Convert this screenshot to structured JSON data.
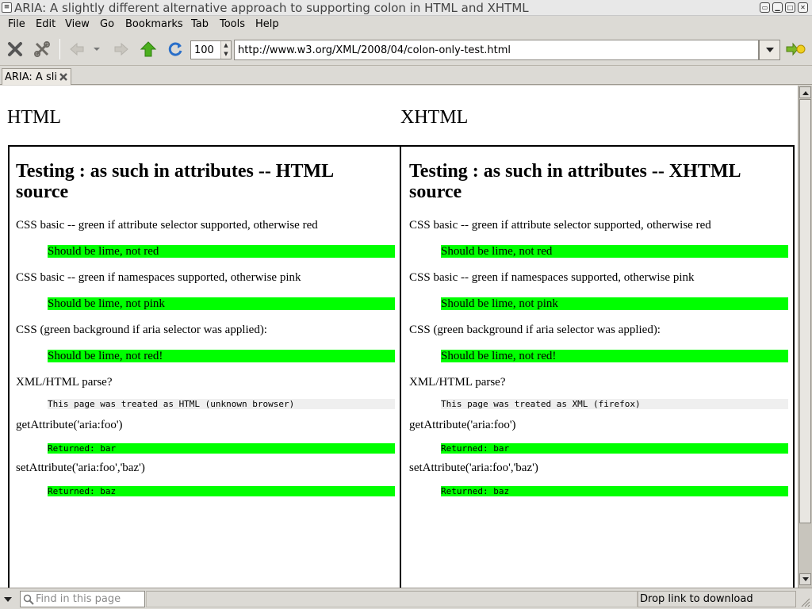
{
  "window": {
    "title": "ARIA: A slightly different alternative approach to supporting colon in HTML and XHTML"
  },
  "menu": [
    "File",
    "Edit",
    "View",
    "Go",
    "Bookmarks",
    "Tab",
    "Tools",
    "Help"
  ],
  "toolbar": {
    "zoom": "100",
    "url": "http://www.w3.org/XML/2008/04/colon-only-test.html",
    "icons": [
      "stop-icon",
      "tools-icon",
      "back-icon",
      "history-dropdown-icon",
      "forward-icon",
      "home-up-icon",
      "reload-icon",
      "go-icon"
    ]
  },
  "tab": {
    "label": "ARIA: A sli"
  },
  "page": {
    "left_heading": "HTML",
    "right_heading": "XHTML",
    "left": {
      "title": "Testing : as such in attributes -- HTML source",
      "items": [
        "CSS basic -- green if attribute selector supported, otherwise red",
        "Should be lime, not red",
        "CSS basic -- green if namespaces supported, otherwise pink",
        "Should be lime, not pink",
        "CSS (green background if aria selector was applied):",
        "Should be lime, not red!",
        "XML/HTML parse?",
        "This page was treated as HTML (unknown browser)",
        "getAttribute('aria:foo')",
        "Returned: bar",
        "setAttribute('aria:foo','baz')",
        "Returned: baz"
      ]
    },
    "right": {
      "title": "Testing : as such in attributes -- XHTML source",
      "items": [
        "CSS basic -- green if attribute selector supported, otherwise red",
        "Should be lime, not red",
        "CSS basic -- green if namespaces supported, otherwise pink",
        "Should be lime, not pink",
        "CSS (green background if aria selector was applied):",
        "Should be lime, not red!",
        "XML/HTML parse?",
        "This page was treated as XML (firefox)",
        "getAttribute('aria:foo')",
        "Returned: bar",
        "setAttribute('aria:foo','baz')",
        "Returned: baz"
      ]
    },
    "colors": {
      "pass": "#00ff00",
      "parse_bg": "#efefef"
    }
  },
  "status": {
    "find_placeholder": "Find in this page",
    "text": "Drop link to download"
  }
}
